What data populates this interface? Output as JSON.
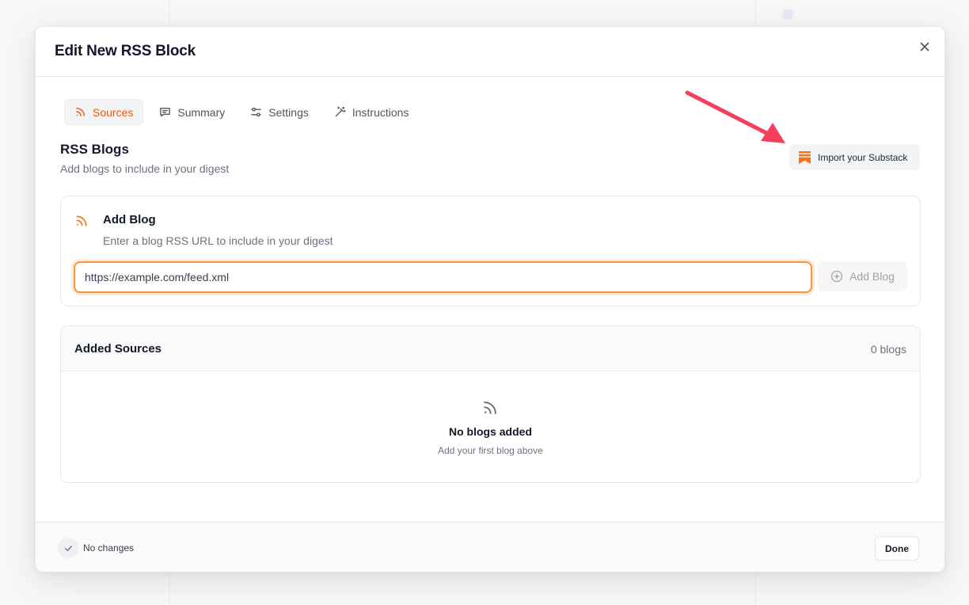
{
  "modal": {
    "title": "Edit New RSS Block",
    "close_icon": "close-icon"
  },
  "tabs": [
    {
      "label": "Sources",
      "icon": "rss-icon",
      "active": true
    },
    {
      "label": "Summary",
      "icon": "message-icon",
      "active": false
    },
    {
      "label": "Settings",
      "icon": "sliders-icon",
      "active": false
    },
    {
      "label": "Instructions",
      "icon": "magic-wand-icon",
      "active": false
    }
  ],
  "section": {
    "title": "RSS Blogs",
    "subtitle": "Add blogs to include in your digest"
  },
  "substack": {
    "label": "Import your Substack",
    "icon": "substack-logo-icon",
    "accent": "#f97316"
  },
  "add_blog": {
    "title": "Add Blog",
    "subtitle": "Enter a blog RSS URL to include in your digest",
    "input_value": "https://example.com/feed.xml",
    "button_label": "Add Blog"
  },
  "sources": {
    "title": "Added Sources",
    "count": "0 blogs",
    "empty_title": "No blogs added",
    "empty_subtitle": "Add your first blog above"
  },
  "footer": {
    "status": "No changes",
    "done_label": "Done"
  },
  "colors": {
    "accent": "#ea580c",
    "annotation_arrow": "#f43f5e"
  }
}
